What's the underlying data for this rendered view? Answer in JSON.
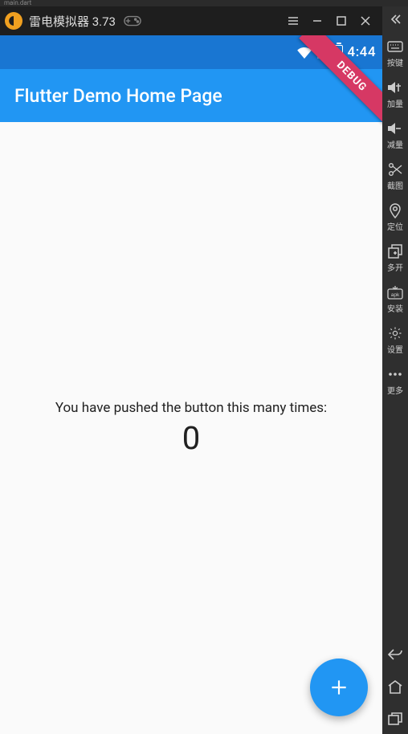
{
  "ide": {
    "tab_name": "main.dart"
  },
  "emulator": {
    "title": "雷电模拟器 3.73"
  },
  "statusbar": {
    "time": "4:44"
  },
  "appbar": {
    "title": "Flutter Demo Home Page"
  },
  "content": {
    "pushed_label": "You have pushed the button this many times:",
    "counter": "0"
  },
  "ribbon": {
    "text": "DEBUG"
  },
  "side_tools": {
    "items": [
      {
        "label": "按键"
      },
      {
        "label": "加量"
      },
      {
        "label": "减量"
      },
      {
        "label": "截图"
      },
      {
        "label": "定位"
      },
      {
        "label": "多开"
      },
      {
        "label": "安装"
      },
      {
        "label": "设置"
      },
      {
        "label": "更多"
      }
    ]
  }
}
